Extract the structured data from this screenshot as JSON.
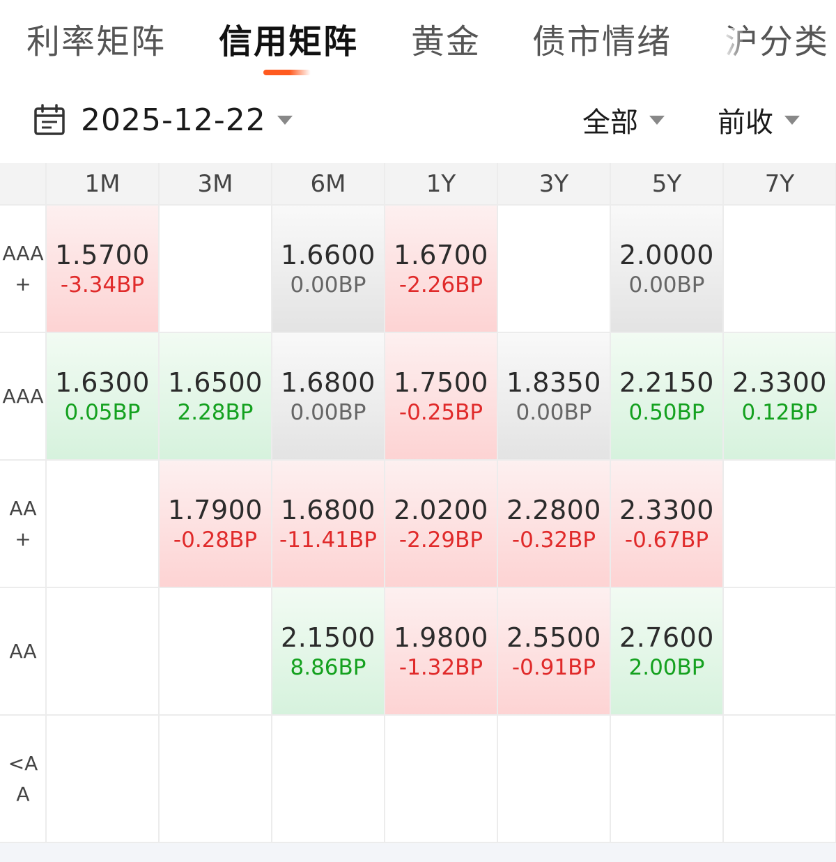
{
  "tabs": [
    {
      "label": "利率矩阵",
      "active": false
    },
    {
      "label": "信用矩阵",
      "active": true
    },
    {
      "label": "黄金",
      "active": false
    },
    {
      "label": "债市情绪",
      "active": false
    },
    {
      "label": "沪分类",
      "active": false
    }
  ],
  "filters": {
    "date": "2025-12-22",
    "scope": "全部",
    "price_basis": "前收"
  },
  "icons": {
    "calendar": "calendar-icon",
    "dropdown": "caret-down-icon"
  },
  "colors": {
    "accent": "#ff5a1f",
    "up": "#e02a2a",
    "down": "#14a11f",
    "flat": "#666666"
  },
  "matrix": {
    "columns": [
      "1M",
      "3M",
      "6M",
      "1Y",
      "3Y",
      "5Y",
      "7Y"
    ],
    "rows": [
      {
        "label": "AAA+",
        "cells": [
          {
            "value": "1.5700",
            "change": "-3.34BP",
            "trend": "red"
          },
          null,
          {
            "value": "1.6600",
            "change": "0.00BP",
            "trend": "gray"
          },
          {
            "value": "1.6700",
            "change": "-2.26BP",
            "trend": "red"
          },
          null,
          {
            "value": "2.0000",
            "change": "0.00BP",
            "trend": "gray"
          },
          null
        ]
      },
      {
        "label": "AAA",
        "cells": [
          {
            "value": "1.6300",
            "change": "0.05BP",
            "trend": "green"
          },
          {
            "value": "1.6500",
            "change": "2.28BP",
            "trend": "green"
          },
          {
            "value": "1.6800",
            "change": "0.00BP",
            "trend": "gray"
          },
          {
            "value": "1.7500",
            "change": "-0.25BP",
            "trend": "red"
          },
          {
            "value": "1.8350",
            "change": "0.00BP",
            "trend": "gray"
          },
          {
            "value": "2.2150",
            "change": "0.50BP",
            "trend": "green"
          },
          {
            "value": "2.3300",
            "change": "0.12BP",
            "trend": "green"
          }
        ]
      },
      {
        "label": "AA+",
        "cells": [
          null,
          {
            "value": "1.7900",
            "change": "-0.28BP",
            "trend": "red"
          },
          {
            "value": "1.6800",
            "change": "-11.41BP",
            "trend": "red"
          },
          {
            "value": "2.0200",
            "change": "-2.29BP",
            "trend": "red"
          },
          {
            "value": "2.2800",
            "change": "-0.32BP",
            "trend": "red"
          },
          {
            "value": "2.3300",
            "change": "-0.67BP",
            "trend": "red"
          },
          null
        ]
      },
      {
        "label": "AA",
        "cells": [
          null,
          null,
          {
            "value": "2.1500",
            "change": "8.86BP",
            "trend": "green"
          },
          {
            "value": "1.9800",
            "change": "-1.32BP",
            "trend": "red"
          },
          {
            "value": "2.5500",
            "change": "-0.91BP",
            "trend": "red"
          },
          {
            "value": "2.7600",
            "change": "2.00BP",
            "trend": "green"
          },
          null
        ]
      },
      {
        "label": "<AA",
        "cells": [
          null,
          null,
          null,
          null,
          null,
          null,
          null
        ]
      }
    ]
  }
}
